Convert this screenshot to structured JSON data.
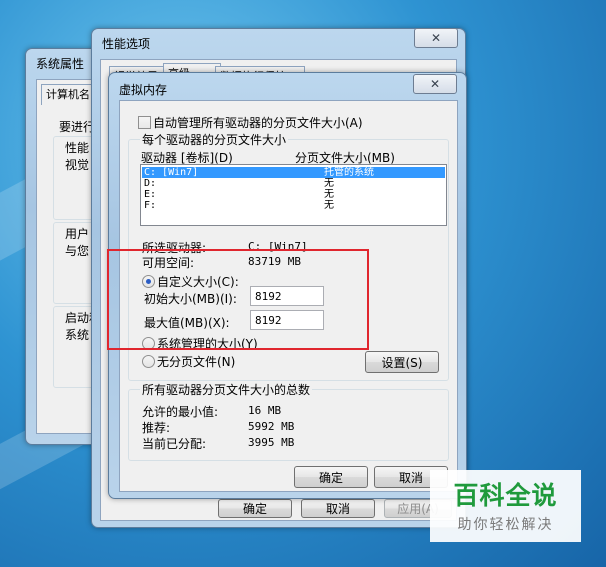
{
  "sys_props": {
    "title": "系统属性",
    "tab_computer": "计算机名",
    "text_lines": [
      "要进行",
      "性能",
      "视觉",
      "用户",
      "与您",
      "启动和",
      "系统"
    ]
  },
  "perf_options": {
    "title": "性能选项",
    "tabs": [
      "视觉效果",
      "高级",
      "数据执行保护"
    ],
    "buttons": {
      "ok": "确定",
      "cancel": "取消",
      "apply": "应用(A)"
    }
  },
  "virtual_memory": {
    "title": "虚拟内存",
    "auto_manage_label": "自动管理所有驱动器的分页文件大小(A)",
    "auto_manage_checked": false,
    "group_title": "每个驱动器的分页文件大小",
    "col_drive": "驱动器 [卷标](D)",
    "col_size": "分页文件大小(MB)",
    "drives": [
      {
        "drive": "C:    [Win7]",
        "size": "托管的系统",
        "selected": true
      },
      {
        "drive": "D:",
        "size": "无",
        "selected": false
      },
      {
        "drive": "E:",
        "size": "无",
        "selected": false
      },
      {
        "drive": "F:",
        "size": "无",
        "selected": false
      }
    ],
    "selected_drive_label": "所选驱动器:",
    "selected_drive_value": "C:   [Win7]",
    "free_space_label": "可用空间:",
    "free_space_value": "83719 MB",
    "custom_size_label": "自定义大小(C):",
    "custom_size_checked": true,
    "initial_size_label": "初始大小(MB)(I):",
    "initial_size_value": "8192",
    "max_size_label": "最大值(MB)(X):",
    "max_size_value": "8192",
    "system_managed_label": "系统管理的大小(Y)",
    "no_paging_label": "无分页文件(N)",
    "set_button": "设置(S)",
    "totals_title": "所有驱动器分页文件大小的总数",
    "min_allowed_label": "允许的最小值:",
    "min_allowed_value": "16 MB",
    "recommended_label": "推荐:",
    "recommended_value": "5992 MB",
    "allocated_label": "当前已分配:",
    "allocated_value": "3995 MB",
    "ok_button": "确定",
    "cancel_button": "取消"
  },
  "watermark": {
    "title": "百科全说",
    "subtitle": "助你轻松解决"
  }
}
